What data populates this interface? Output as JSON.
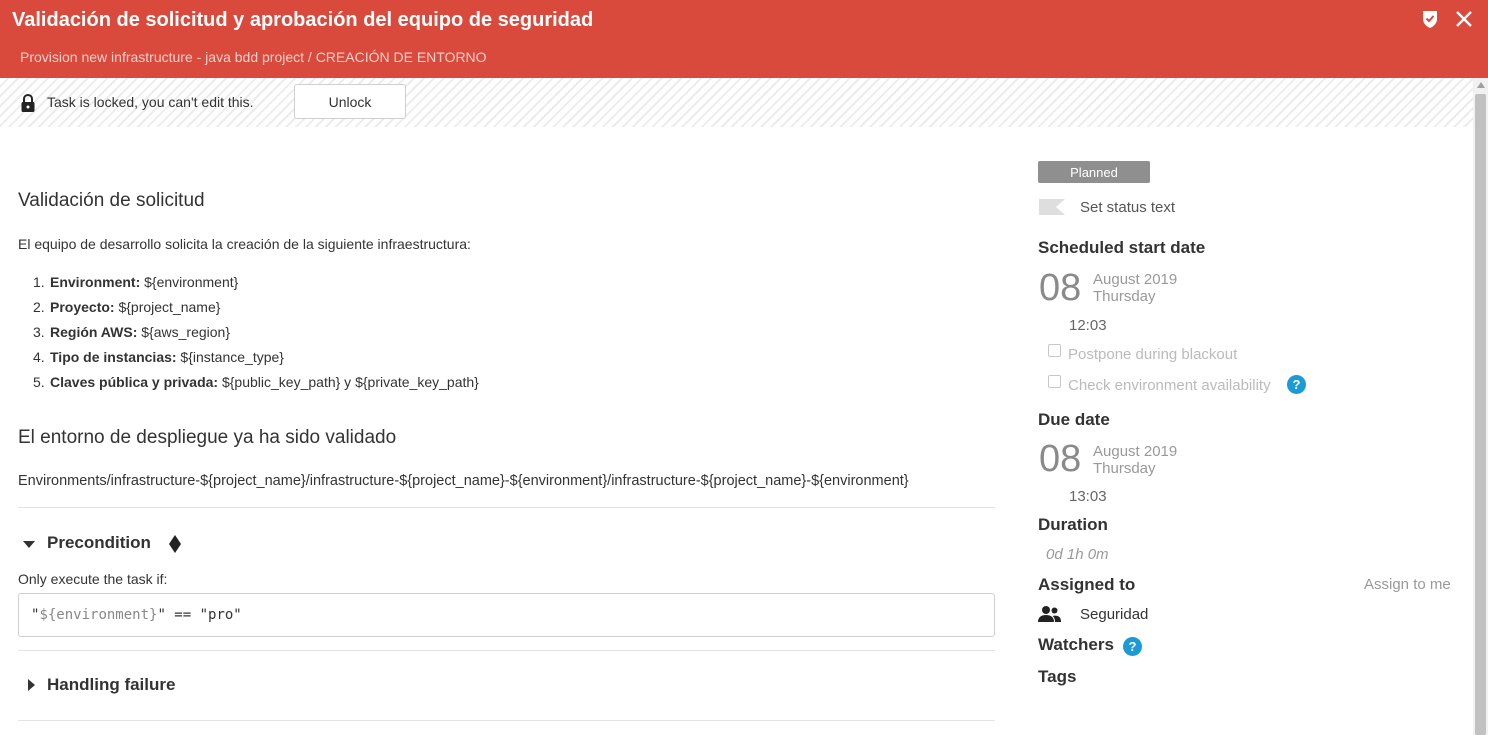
{
  "header": {
    "title": "Validación de solicitud y aprobación del equipo de seguridad",
    "subtitle": "Provision new infrastructure - java bdd project / CREACIÓN DE ENTORNO",
    "icons": [
      "shield-check-icon",
      "close-icon"
    ],
    "color": "#d9493c"
  },
  "lock": {
    "message": "Task is locked, you can't edit this.",
    "button": "Unlock"
  },
  "description": {
    "heading1": "Validación de solicitud",
    "intro": "El equipo de desarrollo solicita la creación de la siguiente infraestructura:",
    "items": [
      {
        "num": "1.",
        "label": "Environment:",
        "value": " ${environment}"
      },
      {
        "num": "2.",
        "label": "Proyecto:",
        "value": " ${project_name}"
      },
      {
        "num": "3.",
        "label": "Región AWS:",
        "value": " ${aws_region}"
      },
      {
        "num": "4.",
        "label": "Tipo de instancias:",
        "value": " ${instance_type}"
      },
      {
        "num": "5.",
        "label": "Claves pública y privada:",
        "value": " ${public_key_path} y ${private_key_path}"
      }
    ],
    "heading2": "El entorno de despliegue ya ha sido validado",
    "path": "Environments/infrastructure-${project_name}/infrastructure-${project_name}-${environment}/infrastructure-${project_name}-${environment}"
  },
  "precondition": {
    "title": "Precondition",
    "label": "Only execute the task if:",
    "code_q1": "\"",
    "code_var": "${environment}",
    "code_rest": "\" == \"pro\""
  },
  "failure": {
    "title": "Handling failure"
  },
  "sidebar": {
    "status": "Planned",
    "status_color": "#8f8f8f",
    "set_status_text": "Set status text",
    "scheduled_start": {
      "heading": "Scheduled start date",
      "day": "08",
      "month_year": "August 2019",
      "weekday": "Thursday",
      "time": "12:03"
    },
    "postpone_label": "Postpone during blackout",
    "check_env_label": "Check environment availability",
    "due": {
      "heading": "Due date",
      "day": "08",
      "month_year": "August 2019",
      "weekday": "Thursday",
      "time": "13:03"
    },
    "duration_heading": "Duration",
    "duration_value": "0d 1h 0m",
    "assigned_heading": "Assigned to",
    "assign_to_me": "Assign to me",
    "assignee": "Seguridad",
    "watchers_heading": "Watchers",
    "tags_heading": "Tags",
    "help_color": "#1a9bd7"
  }
}
